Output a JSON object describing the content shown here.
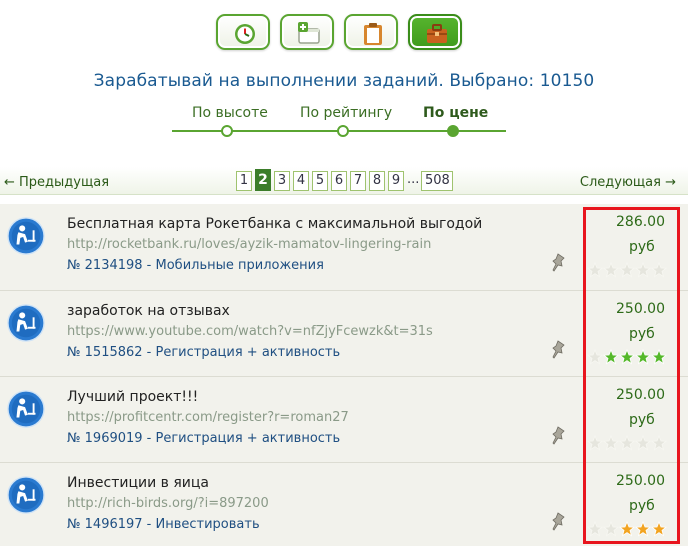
{
  "toolbar": {
    "buttons": [
      {
        "icon": "clock-icon"
      },
      {
        "icon": "add-window-icon"
      },
      {
        "icon": "clipboard-icon"
      },
      {
        "icon": "briefcase-icon",
        "active": true
      }
    ]
  },
  "headline": "Зарабатывай на выполнении заданий. Выбрано: 10150",
  "sort": {
    "options": [
      "По высоте",
      "По рейтингу",
      "По цене"
    ],
    "selected": "По цене"
  },
  "pager": {
    "prev_label": "← Предыдущая",
    "next_label": "Следующая →",
    "pages": [
      "1",
      "2",
      "3",
      "4",
      "5",
      "6",
      "7",
      "8",
      "9",
      "...",
      "508"
    ],
    "current": "2"
  },
  "tasks": [
    {
      "title": "Бесплатная карта Рокетбанка с максимальной выгодой",
      "url": "http://rocketbank.ru/loves/ayzik-mamatov-lingering-rain",
      "meta": "№ 2134198 - Мобильные приложения",
      "price": "286.00",
      "currency": "руб",
      "rating": 0,
      "star_color": "#bdbdb0"
    },
    {
      "title": "заработок на отзывах",
      "url": "https://www.youtube.com/watch?v=nfZjyFcewzk&t=31s",
      "meta": "№ 1515862 - Регистрация + активность",
      "price": "250.00",
      "currency": "руб",
      "rating": 4,
      "star_color": "#55b82a"
    },
    {
      "title": "Лучший проект!!!",
      "url": "https://profitcentr.com/register?r=roman27",
      "meta": "№ 1969019 - Регистрация + активность",
      "price": "250.00",
      "currency": "руб",
      "rating": 0,
      "star_color": "#bdbdb0"
    },
    {
      "title": "Инвестиции в яица",
      "url": "http://rich-birds.org/?i=897200",
      "meta": "№ 1496197 - Инвестировать",
      "price": "250.00",
      "currency": "руб",
      "rating": 3,
      "star_color": "#f2a421"
    }
  ],
  "colors": {
    "accent_green": "#5aa531",
    "headline_blue": "#1a5a91",
    "highlight_red": "#e8151e"
  }
}
